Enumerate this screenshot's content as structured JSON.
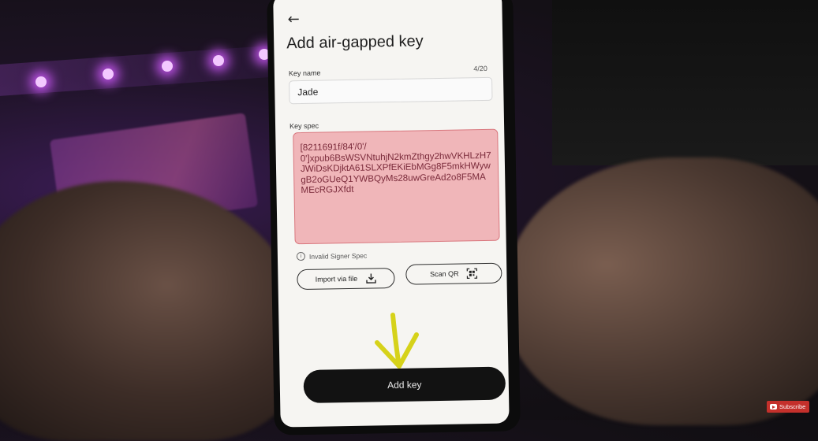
{
  "screen": {
    "back_icon": "arrow-left-icon",
    "title": "Add air-gapped key",
    "key_name": {
      "label": "Key name",
      "counter": "4/20",
      "value": "Jade"
    },
    "key_spec": {
      "label": "Key spec",
      "value": "[8211691f/84'/0'/\n0']xpub6BsWSVNtuhjN2kmZthgy2hwVKHLzH7JWiDsKDjktA61SLXPfEKiEbMGg8F5mkHWywgB2oGUeQ1YWBQyMs28uwGreAd2o8F5MAMEcRGJXfdt",
      "error_icon": "info-circle-icon",
      "error": "Invalid Signer Spec"
    },
    "import_button": {
      "label": "Import via file",
      "icon": "download-icon"
    },
    "scan_button": {
      "label": "Scan QR",
      "icon": "qr-scan-icon"
    },
    "primary_button": {
      "label": "Add key"
    }
  },
  "overlay": {
    "annotation_icon": "down-arrow-annotation-icon",
    "subscribe_label": "Subscribe"
  },
  "colors": {
    "error_fill": "#f0b6b9",
    "error_border": "#d9777e",
    "primary_button": "#121212",
    "annotation": "#d6d21a",
    "subscribe": "#c4302b"
  }
}
